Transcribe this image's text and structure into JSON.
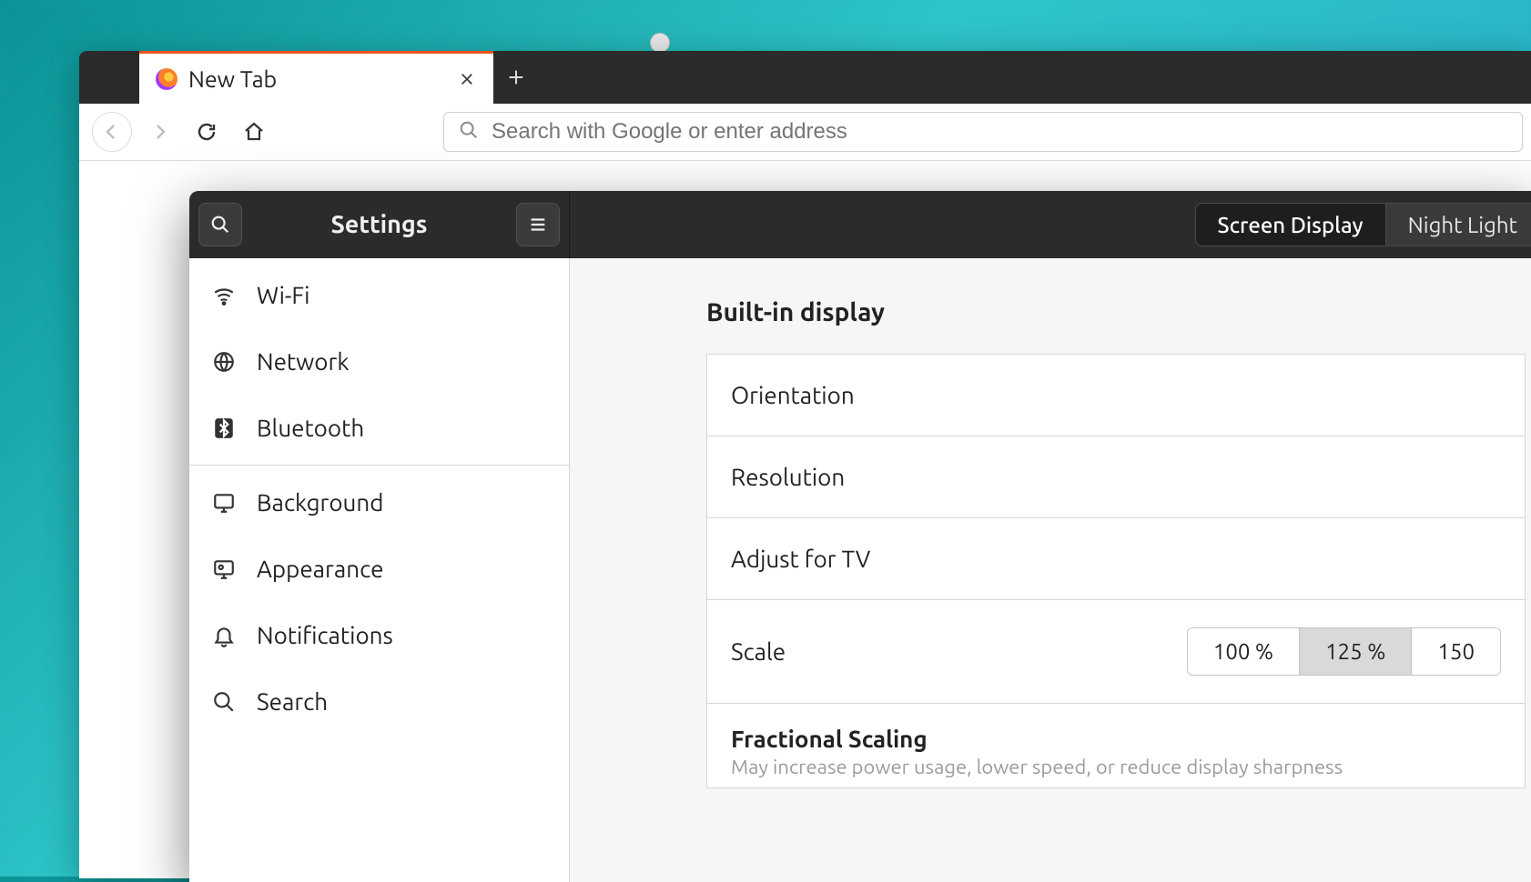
{
  "firefox": {
    "tab_title": "New Tab",
    "url_placeholder": "Search with Google or enter address"
  },
  "settings": {
    "title": "Settings",
    "tabs": {
      "screen": "Screen Display",
      "night": "Night Light"
    },
    "sidebar": {
      "g1": [
        {
          "label": "Wi-Fi"
        },
        {
          "label": "Network"
        },
        {
          "label": "Bluetooth"
        }
      ],
      "g2": [
        {
          "label": "Background"
        },
        {
          "label": "Appearance"
        },
        {
          "label": "Notifications"
        },
        {
          "label": "Search"
        }
      ]
    },
    "content": {
      "section_title": "Built-in display",
      "rows": {
        "orientation": "Orientation",
        "resolution": "Resolution",
        "adjust_tv": "Adjust for TV",
        "scale": "Scale",
        "fractional_title": "Fractional Scaling",
        "fractional_desc": "May increase power usage, lower speed, or reduce display sharpness"
      },
      "scale_options": [
        "100 %",
        "125 %",
        "150"
      ]
    }
  }
}
